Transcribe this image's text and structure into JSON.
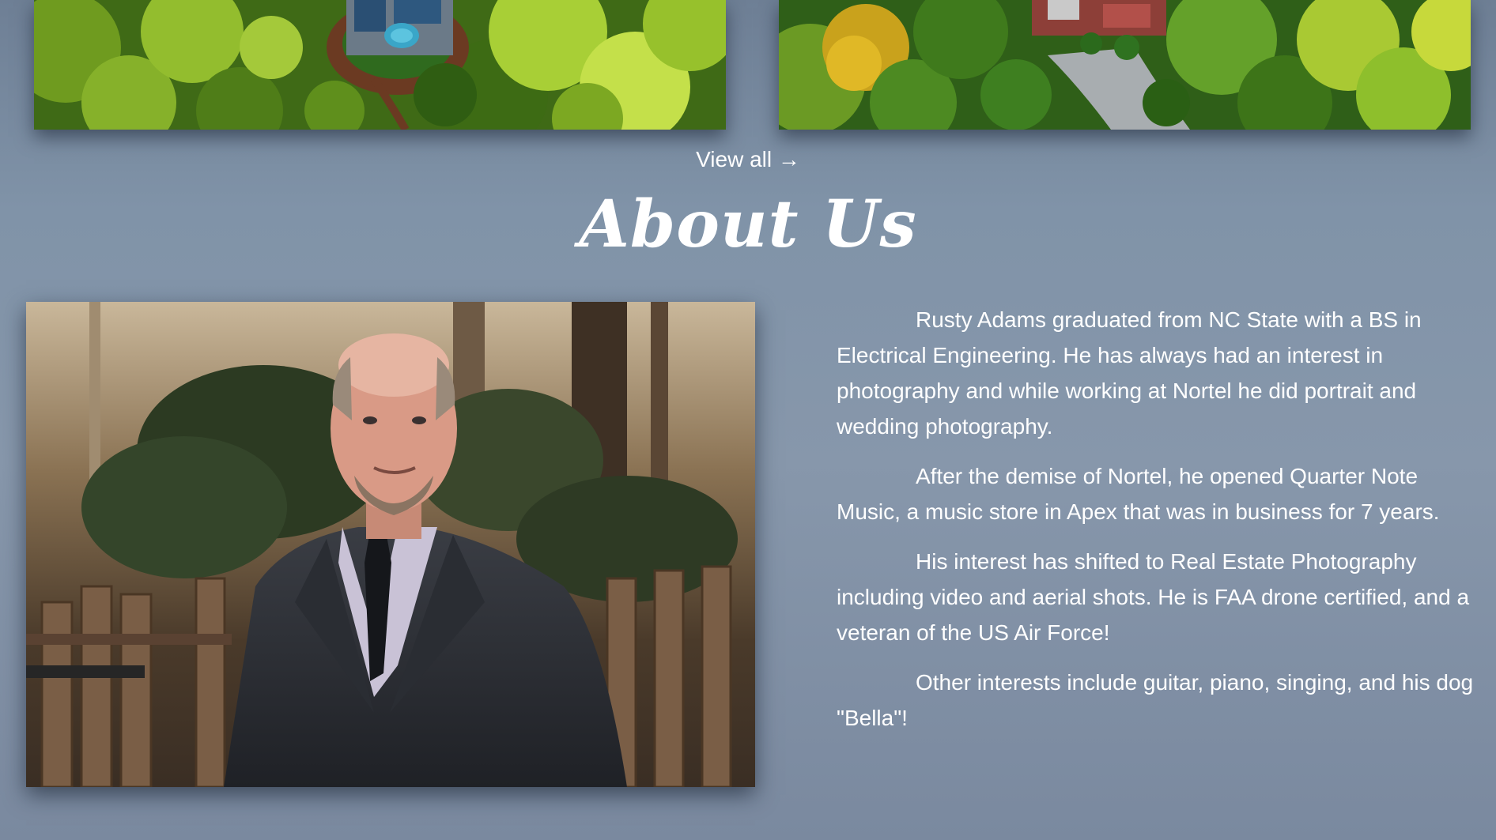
{
  "gallery": {
    "view_all_label": "View all →"
  },
  "about": {
    "heading": "About Us",
    "paragraphs": [
      "Rusty Adams graduated from NC State with a BS in Electrical Engineering. He has always had an interest in photography and while working at Nortel he did portrait and wedding photography.",
      "After the demise of Nortel, he opened Quarter Note Music, a music store in Apex that was in business for 7 years.",
      "His interest has shifted to Real Estate Photography including video and aerial shots. He is FAA drone certified, and a veteran of the US Air Force!",
      "Other interests include guitar, piano, singing, and his dog \"Bella\"!"
    ]
  },
  "colors": {
    "background_top": "#6e7f95",
    "background_mid": "#8797ab",
    "text": "#ffffff"
  }
}
